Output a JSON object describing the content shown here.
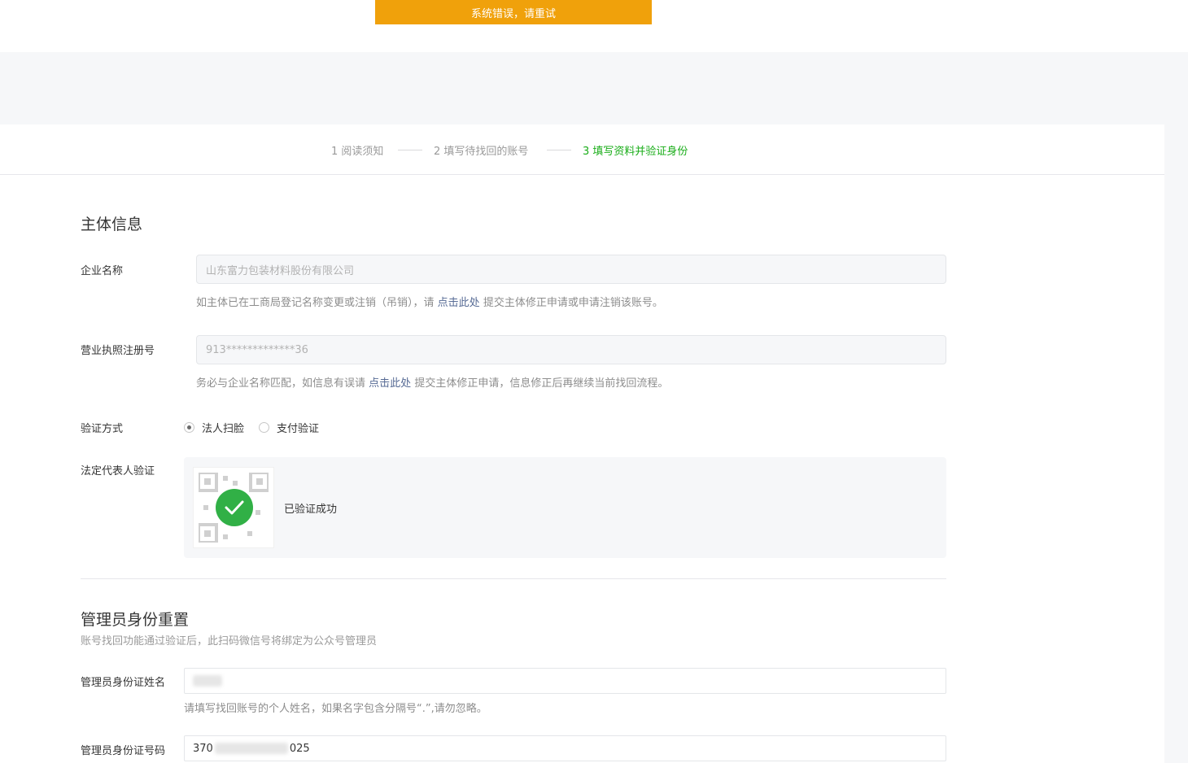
{
  "toast": {
    "text": "系统错误，请重试"
  },
  "steps": [
    {
      "label": "1 阅读须知"
    },
    {
      "label": "2 填写待找回的账号"
    },
    {
      "label": "3 填写资料并验证身份"
    }
  ],
  "subject": {
    "title": "主体信息",
    "company_label": "企业名称",
    "company_value": "山东富力包装材料股份有限公司",
    "company_hint_prefix": "如主体已在工商局登记名称变更或注销（吊销），请",
    "company_hint_link": "点击此处",
    "company_hint_suffix": "提交主体修正申请或申请注销该账号。",
    "license_label": "营业执照注册号",
    "license_value": "913*************36",
    "license_hint_prefix": "务必与企业名称匹配，如信息有误请",
    "license_hint_link": "点击此处",
    "license_hint_suffix": "提交主体修正申请，信息修正后再继续当前找回流程。",
    "verify_method_label": "验证方式",
    "verify_options": [
      {
        "label": "法人扫脸",
        "checked": true
      },
      {
        "label": "支付验证",
        "checked": false
      }
    ],
    "legal_verify_label": "法定代表人验证",
    "verify_status": "已验证成功"
  },
  "admin": {
    "title": "管理员身份重置",
    "subtitle": "账号找回功能通过验证后，此扫码微信号将绑定为公众号管理员",
    "name_label": "管理员身份证姓名",
    "name_hint": "请填写找回账号的个人姓名，如果名字包含分隔号“.”,请勿忽略。",
    "id_label": "管理员身份证号码",
    "id_value_prefix": "370",
    "id_value_suffix": "025"
  },
  "colors": {
    "toast_bg": "#f0a10b",
    "active_step": "#1aad19",
    "success_green": "#31b046",
    "link": "#576b95"
  }
}
